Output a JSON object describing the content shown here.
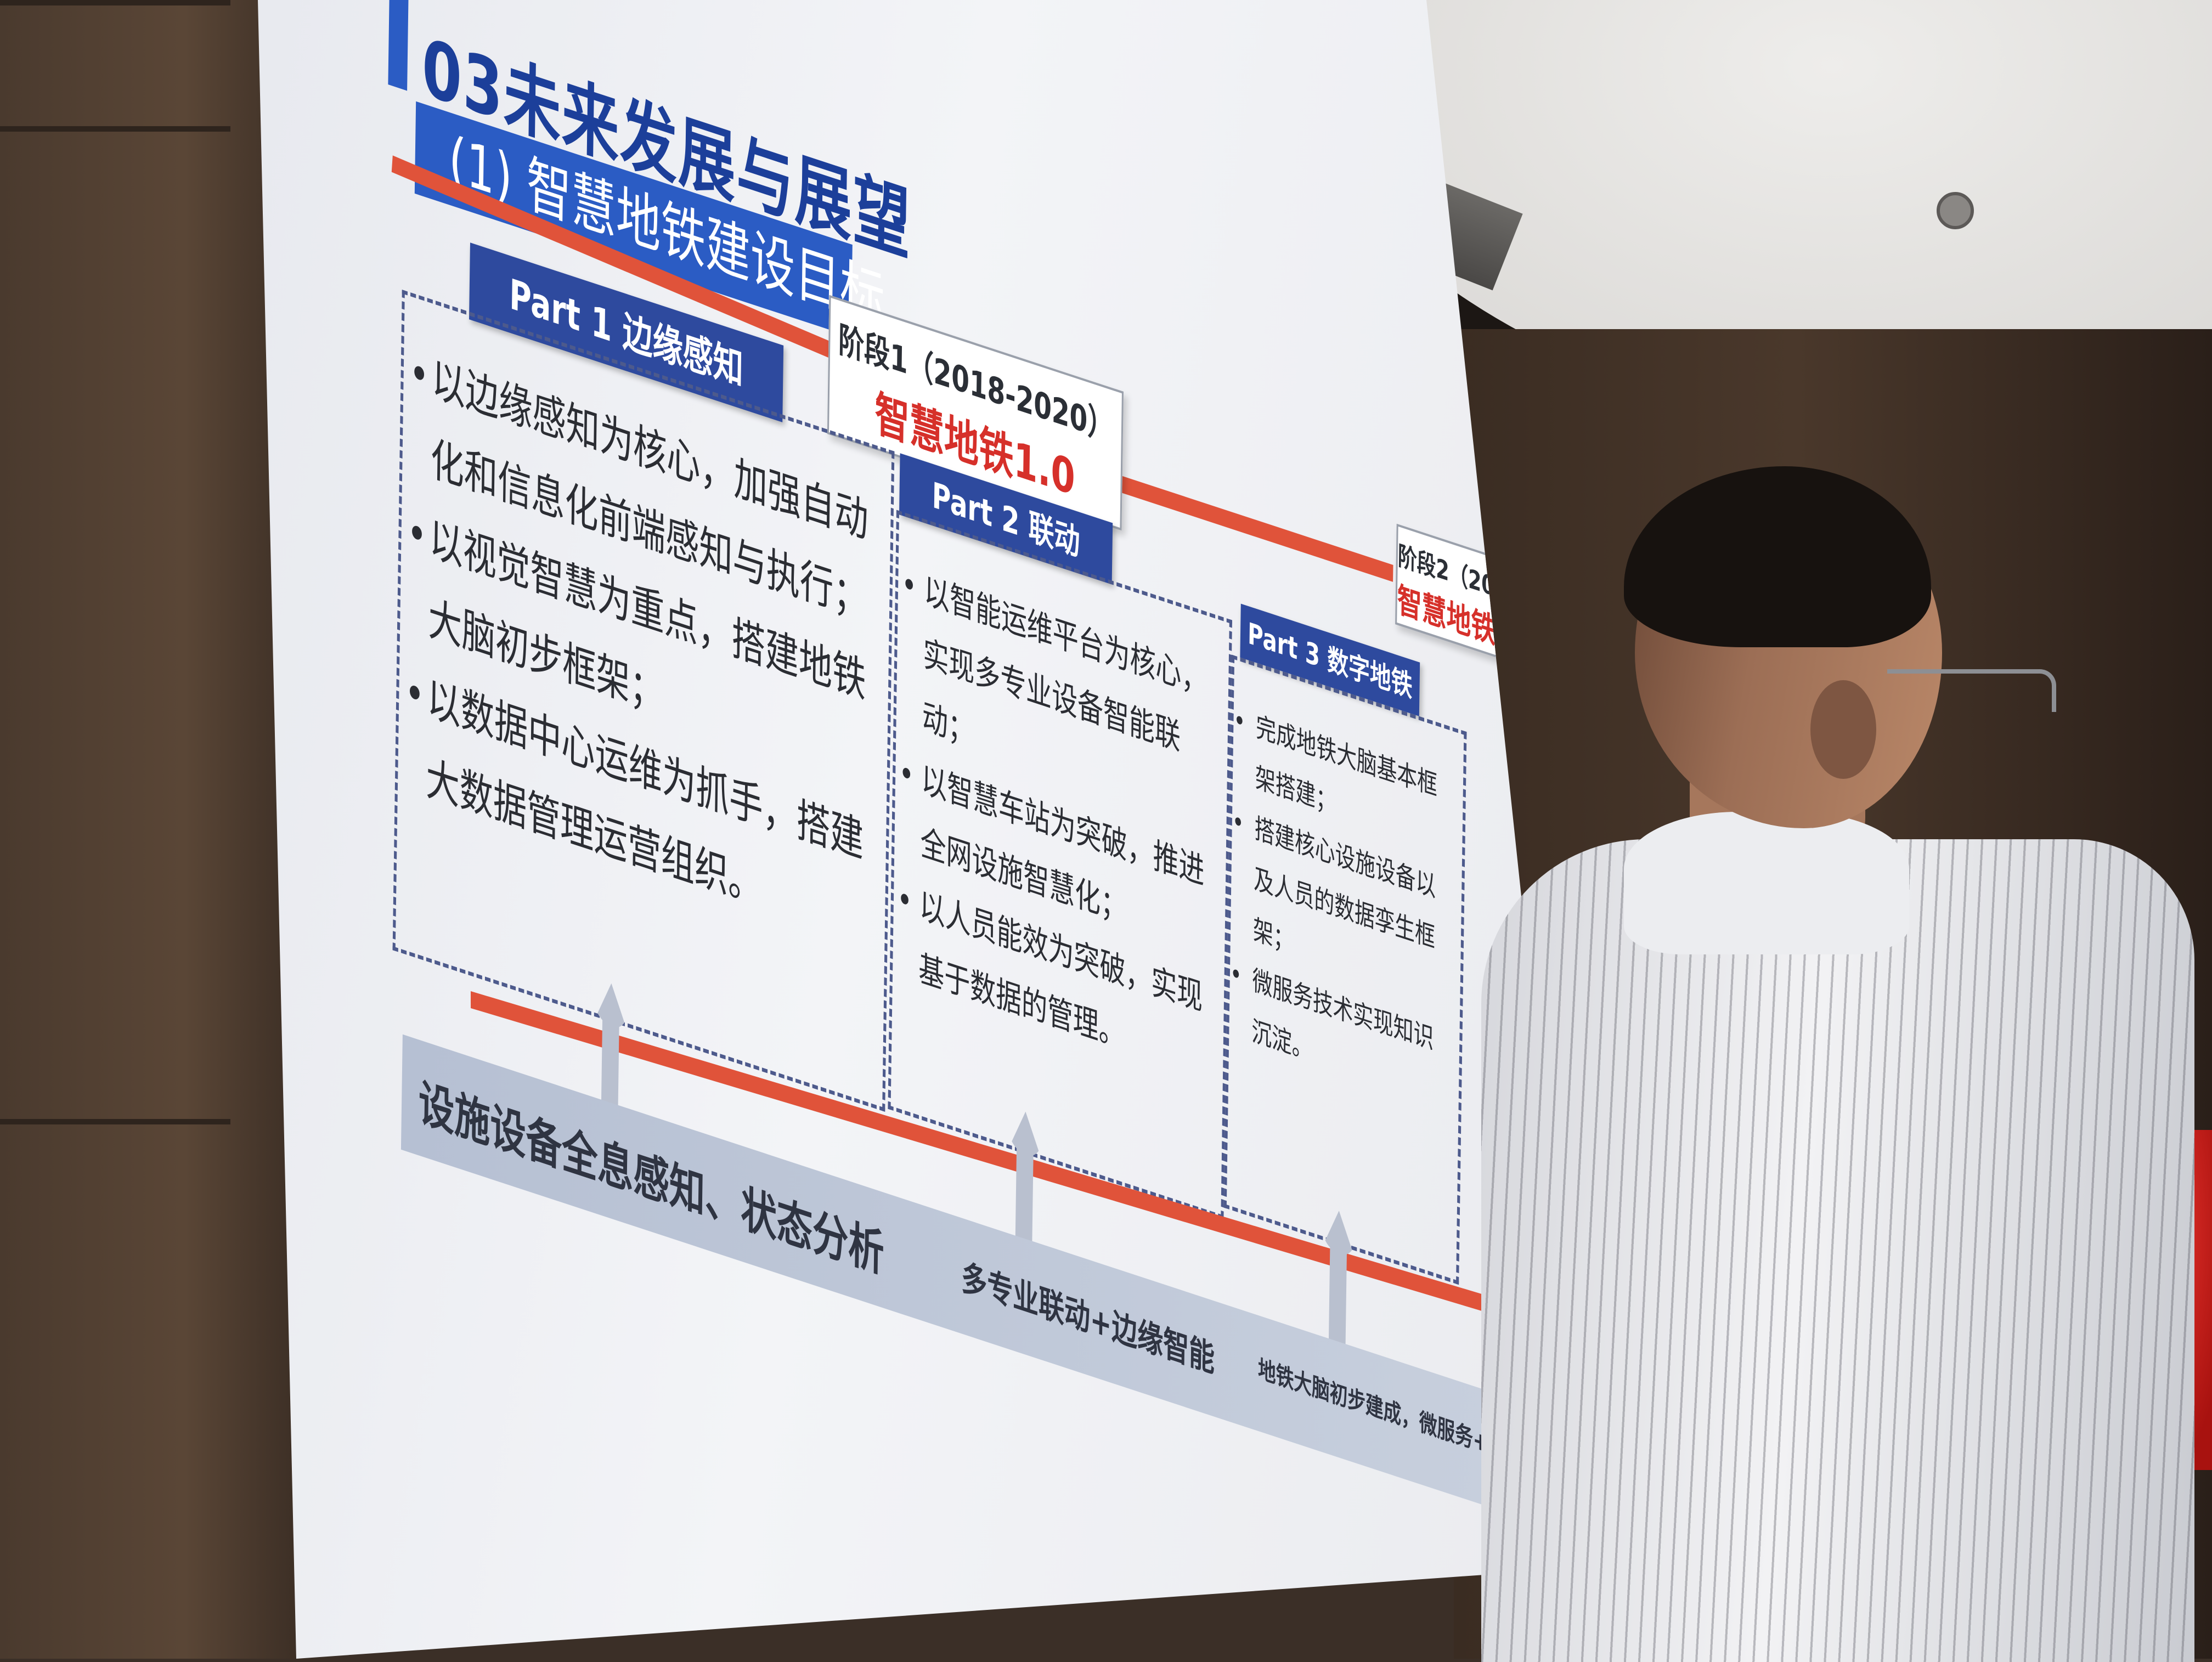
{
  "slide": {
    "title": "03未来发展与展望",
    "subtitle": "(1) 智慧地铁建设目标",
    "stages": [
      {
        "label": "阶段1（2018-2020）",
        "version": "智慧地铁1.0"
      },
      {
        "label": "阶段2（2020-）",
        "version": "智慧地铁2.0"
      }
    ],
    "parts": [
      {
        "tag": "Part 1  边缘感知",
        "bullets": [
          "以边缘感知为核心，加强自动化和信息化前端感知与执行；",
          "以视觉智慧为重点，搭建地铁大脑初步框架；",
          "以数据中心运维为抓手，搭建大数据管理运营组织。"
        ]
      },
      {
        "tag": "Part 2  联动",
        "bullets": [
          "以智能运维平台为核心，实现多专业设备智能联动；",
          "以智慧车站为突破，推进全网设施智慧化；",
          "以人员能效为突破，实现基于数据的管理。"
        ]
      },
      {
        "tag": "Part 3  数字地铁",
        "bullets": [
          "完成地铁大脑基本框架搭建；",
          "搭建核心设施设备以及人员的数据孪生框架；",
          "微服务技术实现知识沉淀。"
        ]
      }
    ],
    "bottom_labels": [
      "设施设备全息感知、状态分析",
      "多专业联动+边缘智能",
      "地铁大脑初步建成，微服务+智慧化应用"
    ]
  },
  "colors": {
    "title_blue": "#1c3f9a",
    "subtitle_blue": "#2b5cc4",
    "part_tag_blue": "#2e4a9e",
    "timeline_red": "#e0533a",
    "version_red": "#d6302a",
    "band_gray": "#b6c0d3"
  }
}
